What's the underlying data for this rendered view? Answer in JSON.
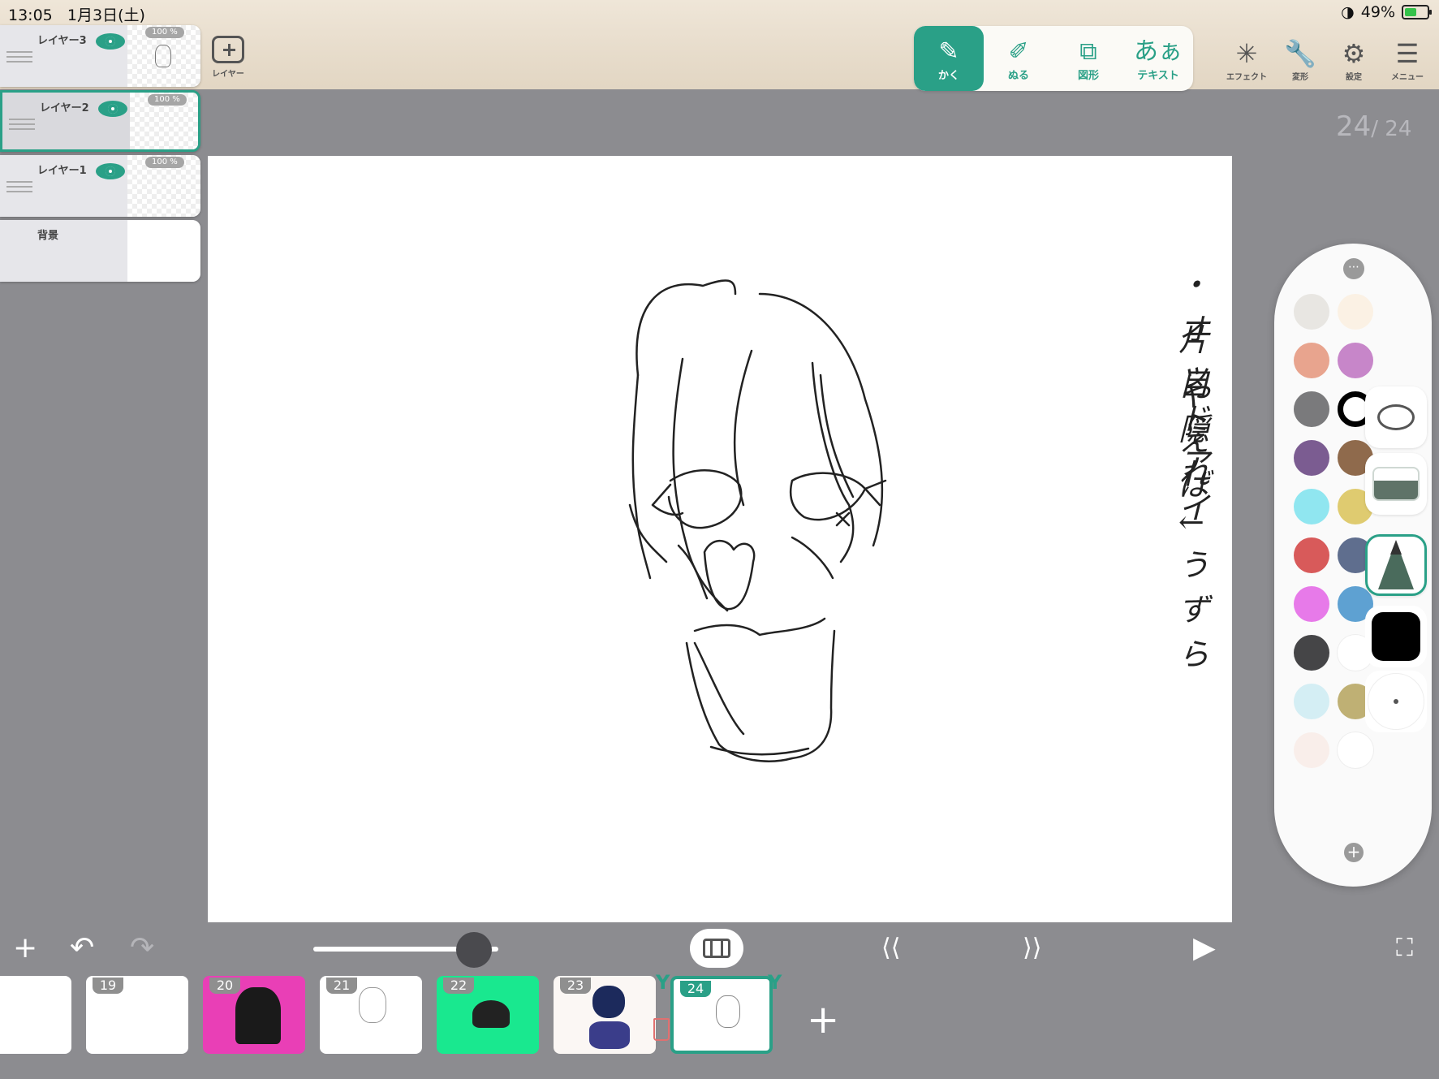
{
  "status": {
    "time": "13:05",
    "date": "1月3日(土)",
    "battery": "49%",
    "battery_level": 0.49
  },
  "top": {
    "add_layer_label": "レイヤー",
    "tools": [
      {
        "label": "かく",
        "icon": "pencil-icon",
        "active": true
      },
      {
        "label": "ぬる",
        "icon": "brush-icon",
        "active": false
      },
      {
        "label": "図形",
        "icon": "shapes-icon",
        "active": false
      },
      {
        "label": "テキスト",
        "icon": "text-icon",
        "glyph": "あぁ",
        "active": false
      }
    ],
    "right_menu": [
      {
        "label": "エフェクト",
        "icon": "sparkle-icon"
      },
      {
        "label": "変形",
        "icon": "wrench-icon"
      },
      {
        "label": "設定",
        "icon": "gear-icon"
      },
      {
        "label": "メニュー",
        "icon": "hamburger-icon"
      }
    ]
  },
  "layers": [
    {
      "name": "レイヤー3",
      "opacity": "100 %",
      "visible": true,
      "selected": false
    },
    {
      "name": "レイヤー2",
      "opacity": "100 %",
      "visible": true,
      "selected": true
    },
    {
      "name": "レイヤー1",
      "opacity": "100 %",
      "visible": true,
      "selected": false
    },
    {
      "name": "背景",
      "opacity": "",
      "visible": false,
      "selected": false
    }
  ],
  "page": {
    "current": "24",
    "total": "/ 24"
  },
  "canvas_notes": [
    "・オッドアイ",
    "片目隠れ",
    "やえば ←うずら"
  ],
  "palette": {
    "colors": [
      "#e8e6e2",
      "#fbf1e4",
      "#e8a48e",
      "#c786c9",
      "#7a7a7c",
      "#000000",
      "#7b5c91",
      "#8f6a4c",
      "#90e6f0",
      "#dfcb70",
      "#d85a5a",
      "#5f6e8e",
      "#e77ae9",
      "#5ea1d2",
      "#454547",
      "#ffffff",
      "#d4eef4",
      "#bfb074",
      "#f9eeea",
      "#ffffff"
    ],
    "selected_color": "#000000",
    "tools": [
      "lasso-icon",
      "eraser-icon",
      "pencil-tool-icon",
      "black-color-swatch",
      "brush-size-icon"
    ]
  },
  "bottom": {
    "zoom_level": 0.78
  },
  "frames": [
    {
      "num": "",
      "bg": "#ffffff"
    },
    {
      "num": "19",
      "bg": "#ffffff"
    },
    {
      "num": "20",
      "bg": "#e93fb6"
    },
    {
      "num": "21",
      "bg": "#ffffff"
    },
    {
      "num": "22",
      "bg": "#19e88f"
    },
    {
      "num": "23",
      "bg": "#fbf7f4"
    },
    {
      "num": "24",
      "bg": "#ffffff"
    }
  ]
}
